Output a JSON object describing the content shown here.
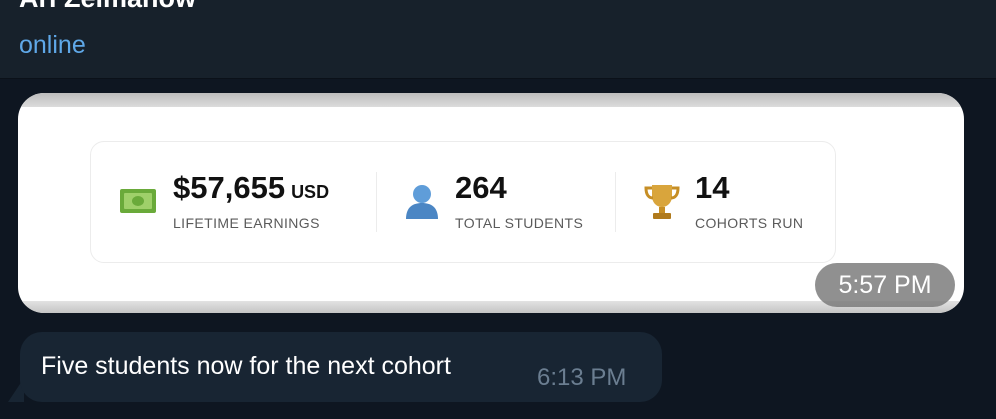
{
  "header": {
    "contact_name": "Ari Zelmanow",
    "status": "online"
  },
  "messages": [
    {
      "type": "image",
      "time": "5:57 PM",
      "stats": [
        {
          "icon": "money-icon",
          "value": "$57,655",
          "unit": "USD",
          "label": "LIFETIME EARNINGS"
        },
        {
          "icon": "user-icon",
          "value": "264",
          "label": "TOTAL STUDENTS"
        },
        {
          "icon": "trophy-icon",
          "value": "14",
          "label": "COHORTS RUN"
        }
      ]
    },
    {
      "type": "text",
      "text": "Five students now for the next cohort",
      "time": "6:13 PM"
    }
  ],
  "colors": {
    "background": "#0e1621",
    "header": "#17212b",
    "accent": "#5fa8e8",
    "incoming_bubble": "#182533"
  }
}
